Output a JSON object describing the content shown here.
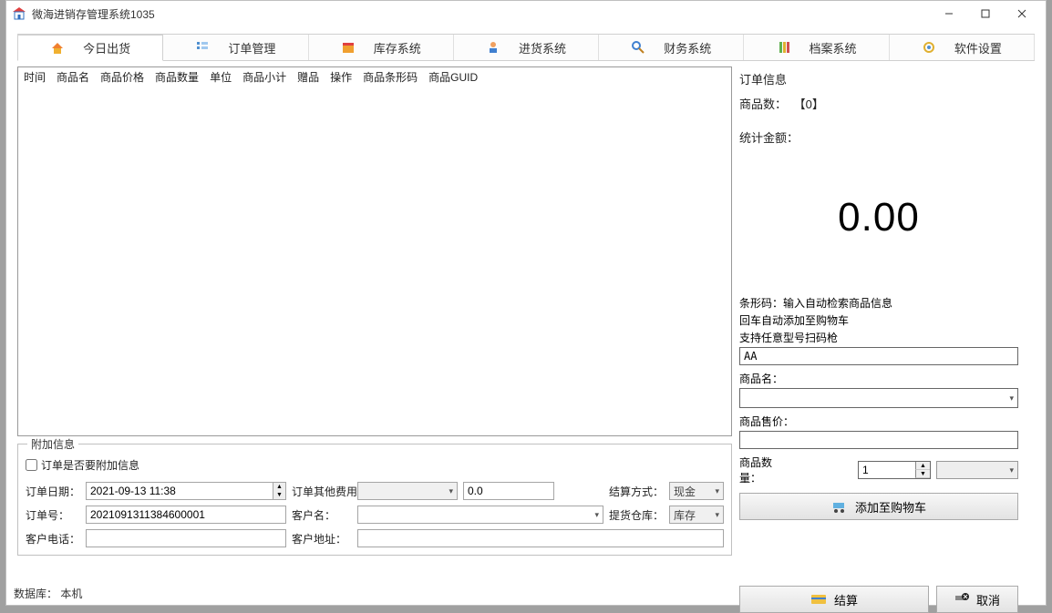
{
  "window": {
    "title": "微海进销存管理系统1035"
  },
  "tabs": [
    {
      "label": "今日出货"
    },
    {
      "label": "订单管理"
    },
    {
      "label": "库存系统"
    },
    {
      "label": "进货系统"
    },
    {
      "label": "财务系统"
    },
    {
      "label": "档案系统"
    },
    {
      "label": "软件设置"
    }
  ],
  "table": {
    "columns": [
      "时间",
      "商品名",
      "商品价格",
      "商品数量",
      "单位",
      "商品小计",
      "赠品",
      "操作",
      "商品条形码",
      "商品GUID"
    ]
  },
  "extra": {
    "legend": "附加信息",
    "checkbox_label": "订单是否要附加信息",
    "order_date_label": "订单日期：",
    "order_date_value": "2021-09-13 11:38",
    "other_fee_label": "订单其他费用：",
    "other_fee_value": "0.0",
    "pay_method_label": "结算方式：",
    "pay_method_value": "现金",
    "order_no_label": "订单号：",
    "order_no_value": "2021091311384600001",
    "customer_name_label": "客户名：",
    "pickup_store_label": "提货仓库：",
    "pickup_store_value": "库存",
    "customer_phone_label": "客户电话：",
    "customer_addr_label": "客户地址："
  },
  "info": {
    "title": "订单信息",
    "count_label": "商品数：",
    "count_value": "【0】",
    "total_label": "统计金额：",
    "total_amount": "0.00",
    "barcode_hint1": "条形码：输入自动检索商品信息",
    "barcode_hint2": "回车自动添加至购物车",
    "barcode_hint3": "支持任意型号扫码枪",
    "barcode_value": "AA",
    "product_name_label": "商品名：",
    "price_label": "商品售价：",
    "qty_label": "商品数量：",
    "qty_value": "1",
    "add_cart_label": "添加至购物车",
    "settle_label": "结算",
    "cancel_label": "取消"
  },
  "status": {
    "db_label": "数据库：",
    "db_value": "本机"
  }
}
